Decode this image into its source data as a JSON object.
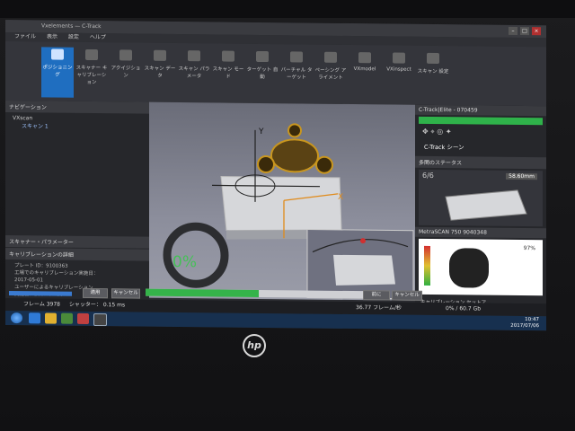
{
  "window": {
    "title": "Vxelements — C-Track",
    "min": "–",
    "max": "□",
    "close": "×"
  },
  "menu": [
    "ファイル",
    "表示",
    "設定",
    "ヘルプ"
  ],
  "ribbon": [
    {
      "label": "ポジショニング",
      "active": true
    },
    {
      "label": "スキャナー キャリブレーション",
      "active": false
    },
    {
      "label": "アクイジション",
      "active": false
    },
    {
      "label": "スキャン データ",
      "active": false
    },
    {
      "label": "スキャン パラメータ",
      "active": false
    },
    {
      "label": "スキャン モード",
      "active": false
    },
    {
      "label": "ターゲット 自動",
      "active": false
    },
    {
      "label": "バーチャル ターゲット",
      "active": false
    },
    {
      "label": "ペーシング アライメント",
      "active": false
    },
    {
      "label": "VXmodel",
      "active": false
    },
    {
      "label": "VXinspect",
      "active": false
    },
    {
      "label": "スキャン 設定",
      "active": false
    }
  ],
  "navigation": {
    "header": "ナビゲーション",
    "root": "VXscan",
    "child": "スキャン 1"
  },
  "scanner_params": {
    "header": "スキャナー・パラメーター"
  },
  "calibration": {
    "header": "キャリブレーションの詳細",
    "lines": [
      "プレート ID：9100363",
      "工場でのキャリブレーション実施日：",
      "2017-05-01",
      "ユーザーによるキャリブレーション",
      "実施日：2017-07-06"
    ],
    "apply": "適用",
    "cancel": "キャンセル"
  },
  "viewport": {
    "percent": "0%",
    "axis_x": "X",
    "axis_y": "Y"
  },
  "right": {
    "title": "C-Track|Elite - 070459",
    "scene": "C-Track シーン",
    "status": "多関のステータス",
    "count": "6/6",
    "distance": "58.60mm",
    "scanner": "MetraSCAN 750 9040348",
    "scanner_pct": "97%",
    "calib_label": "キャリブレーション セットア"
  },
  "bottom": {
    "previous": "前に",
    "cancel": "キャンセル",
    "progress": 0.52
  },
  "status": {
    "frame": "フレーム 3978",
    "shutter": "シャッター： 0.15 ms",
    "rate": "36.77 フレーム/秒",
    "memory": "0% / 60.7 Gb"
  },
  "clock": {
    "time": "10:47",
    "date": "2017/07/06"
  },
  "brand": {
    "logo": "hp"
  }
}
